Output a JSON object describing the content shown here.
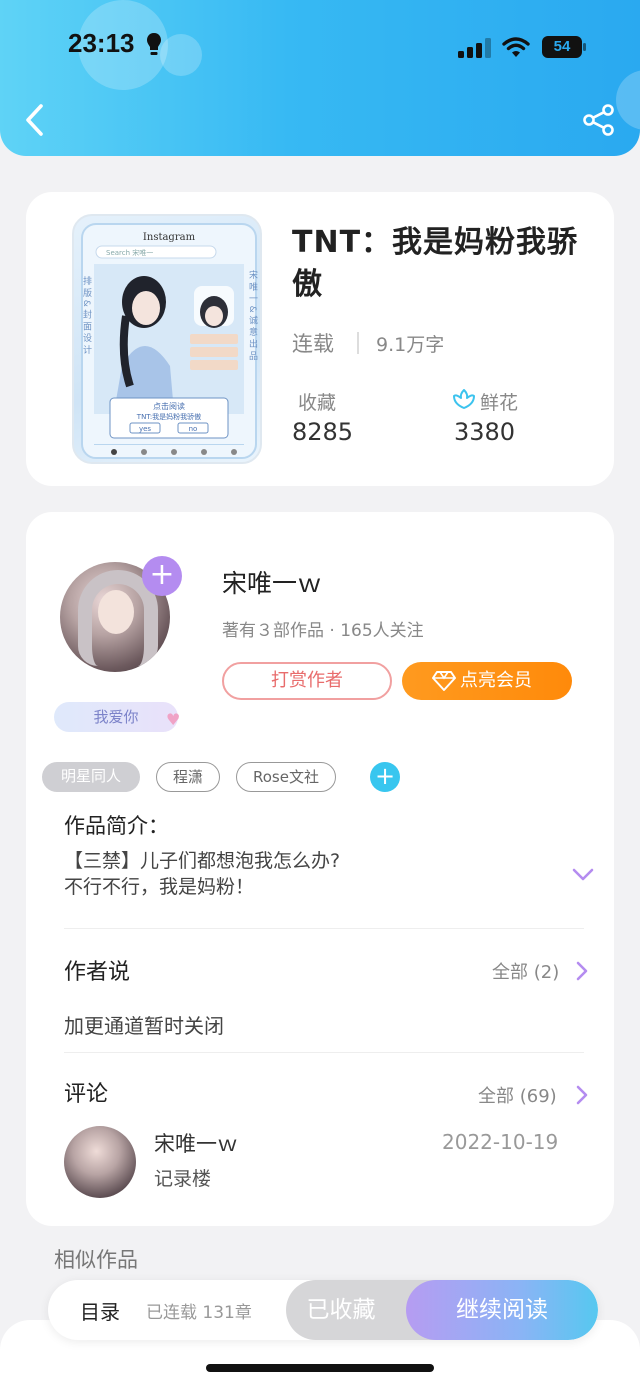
{
  "status_bar": {
    "time": "23:13",
    "battery": "54"
  },
  "header": {
    "back_icon": "chevron-left-icon",
    "share_icon": "share-icon"
  },
  "book": {
    "title": "TNT：我是妈粉我骄傲",
    "status": "连载",
    "word_count": "9.1万字",
    "collect_label": "收藏",
    "collect_value": "8285",
    "flower_label": "鲜花",
    "flower_value": "3380",
    "cover_text": {
      "header": "Instagram",
      "search": "Search 宋唯一",
      "side_left": "排 版 & 封 面 设 计",
      "side_right": "宋 唯 一 & 诚 意 出 品",
      "cta_line1": "点击阅读",
      "cta_line2": "TNT:我是妈粉我骄傲",
      "yes": "yes",
      "no": "no"
    }
  },
  "author": {
    "name": "宋唯一ｗ",
    "meta": "著有３部作品 · 165人关注",
    "badge": "我爱你",
    "tip_label": "打赏作者",
    "vip_label": "点亮会员"
  },
  "tags": [
    "明星同人",
    "程潇",
    "Rose文社"
  ],
  "intro": {
    "title": "作品简介：",
    "line1": "【三禁】儿子们都想泡我怎么办?",
    "line2": "不行不行，我是妈粉！"
  },
  "author_says": {
    "title": "作者说",
    "all_label": "全部 (2)",
    "text": "加更通道暂时关闭"
  },
  "comments": {
    "title": "评论",
    "all_label": "全部 (69)",
    "items": [
      {
        "name": "宋唯一ｗ",
        "date": "2022-10-19",
        "text": "记录楼"
      }
    ]
  },
  "similar_title": "相似作品",
  "bottom_bar": {
    "toc_label": "目录",
    "chapters_label": "已连载 131章",
    "collected_label": "已收藏",
    "continue_label": "继续阅读"
  },
  "colors": {
    "header": "#37b9f3",
    "accent_purple": "#b48cf0",
    "vip_orange": "#ff9a1f",
    "tip_red": "#e86c6c"
  }
}
